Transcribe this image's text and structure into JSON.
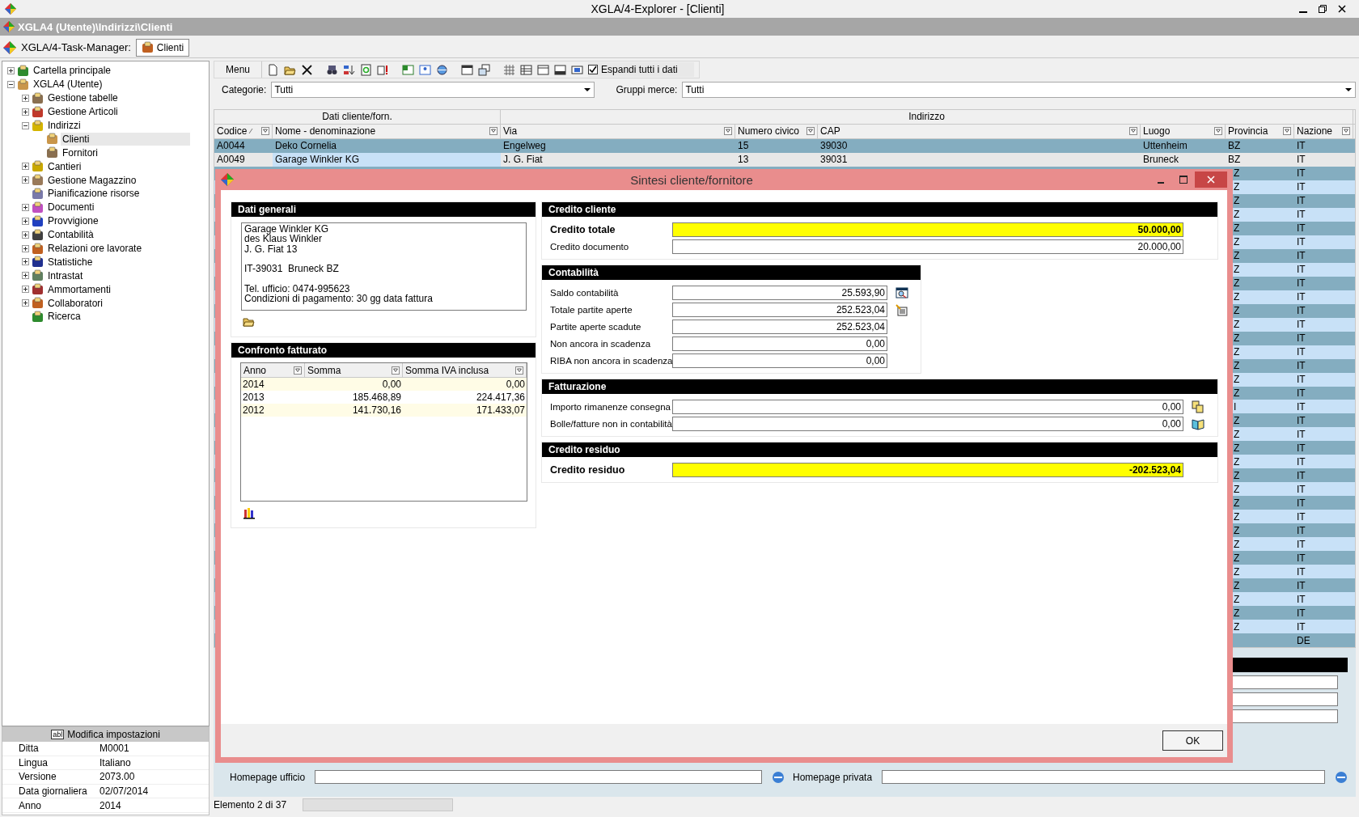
{
  "window": {
    "title": "XGLA/4-Explorer - [Clienti]"
  },
  "path_bar": {
    "text": "XGLA4 (Utente)\\Indirizzi\\Clienti"
  },
  "task_bar": {
    "label": "XGLA/4-Task-Manager:",
    "tabs": [
      {
        "label": "Clienti",
        "selected": true
      }
    ]
  },
  "tree": [
    {
      "label": "Cartella principale",
      "expanded": false,
      "selected": false
    },
    {
      "label": "XGLA4 (Utente)",
      "expanded": true,
      "selected": false,
      "children": [
        {
          "label": "Gestione tabelle",
          "expanded": false,
          "selected": false
        },
        {
          "label": "Gestione Articoli",
          "expanded": false,
          "selected": false
        },
        {
          "label": "Indirizzi",
          "expanded": true,
          "selected": false,
          "children": [
            {
              "label": "Clienti",
              "selected": true
            },
            {
              "label": "Fornitori",
              "selected": false
            }
          ]
        },
        {
          "label": "Cantieri",
          "expanded": false,
          "selected": false
        },
        {
          "label": "Gestione Magazzino",
          "expanded": false,
          "selected": false
        },
        {
          "label": "Pianificazione risorse",
          "selected": false
        },
        {
          "label": "Documenti",
          "expanded": false,
          "selected": false
        },
        {
          "label": "Provvigione",
          "expanded": false,
          "selected": false
        },
        {
          "label": "Contabilità",
          "expanded": false,
          "selected": false
        },
        {
          "label": "Relazioni ore lavorate",
          "expanded": false,
          "selected": false
        },
        {
          "label": "Statistiche",
          "expanded": false,
          "selected": false
        },
        {
          "label": "Intrastat",
          "expanded": false,
          "selected": false
        },
        {
          "label": "Ammortamenti",
          "expanded": false,
          "selected": false
        },
        {
          "label": "Collaboratori",
          "expanded": false,
          "selected": false
        },
        {
          "label": "Ricerca",
          "selected": false
        }
      ]
    }
  ],
  "settings": {
    "icon_text": "abl",
    "title": "Modifica impostazioni",
    "rows": [
      {
        "label": "Ditta",
        "value": "M0001"
      },
      {
        "label": "Lingua",
        "value": "Italiano"
      },
      {
        "label": "Versione",
        "value": "2073.00"
      },
      {
        "label": "Data giornaliera",
        "value": "02/07/2014"
      },
      {
        "label": "Anno",
        "value": "2014"
      }
    ]
  },
  "toolbar": {
    "menu": "Menu",
    "expand_all": {
      "label": "Espandi tutti i dati",
      "checked": true
    }
  },
  "filters": [
    {
      "label": "Categorie:",
      "value": "Tutti"
    },
    {
      "label": "Gruppi merce:",
      "value": "Tutti"
    }
  ],
  "table": {
    "groups": [
      {
        "label": "Dati cliente/forn."
      },
      {
        "label": "Indirizzo"
      }
    ],
    "columns": [
      {
        "label": "Codice",
        "sorted": true
      },
      {
        "label": "Nome - denominazione",
        "sorted": false
      },
      {
        "label": "Via",
        "sorted": false
      },
      {
        "label": "Numero civico",
        "sorted": false
      },
      {
        "label": "CAP",
        "sorted": false
      },
      {
        "label": "Luogo",
        "sorted": false
      },
      {
        "label": "Provincia",
        "sorted": false
      },
      {
        "label": "Nazione",
        "sorted": false
      }
    ],
    "rows": [
      {
        "kind": "full",
        "selected": false,
        "cells": [
          "A0044",
          "Deko Cornelia",
          "Engelweg",
          "15",
          "39030",
          "Uttenheim",
          "BZ",
          "IT"
        ]
      },
      {
        "kind": "full",
        "selected": true,
        "cells": [
          "A0049",
          "Garage Winkler KG",
          "J. G. Fiat",
          "13",
          "39031",
          "Bruneck",
          "BZ",
          "IT"
        ]
      },
      {
        "kind": "covered",
        "selected": false,
        "provincia": "Z",
        "nazione": "IT"
      },
      {
        "kind": "covered",
        "selected": false,
        "provincia": "Z",
        "nazione": "IT"
      },
      {
        "kind": "covered",
        "selected": false,
        "provincia": "Z",
        "nazione": "IT"
      },
      {
        "kind": "covered",
        "selected": false,
        "provincia": "Z",
        "nazione": "IT"
      },
      {
        "kind": "covered",
        "selected": false,
        "provincia": "Z",
        "nazione": "IT"
      },
      {
        "kind": "covered",
        "selected": false,
        "provincia": "Z",
        "nazione": "IT"
      },
      {
        "kind": "covered",
        "selected": false,
        "provincia": "Z",
        "nazione": "IT"
      },
      {
        "kind": "covered",
        "selected": false,
        "provincia": "Z",
        "nazione": "IT"
      },
      {
        "kind": "covered",
        "selected": false,
        "provincia": "Z",
        "nazione": "IT"
      },
      {
        "kind": "covered",
        "selected": false,
        "provincia": "Z",
        "nazione": "IT"
      },
      {
        "kind": "covered",
        "selected": false,
        "provincia": "Z",
        "nazione": "IT"
      },
      {
        "kind": "covered",
        "selected": false,
        "provincia": "Z",
        "nazione": "IT"
      },
      {
        "kind": "covered",
        "selected": false,
        "provincia": "Z",
        "nazione": "IT"
      },
      {
        "kind": "covered",
        "selected": false,
        "provincia": "Z",
        "nazione": "IT"
      },
      {
        "kind": "covered",
        "selected": false,
        "provincia": "Z",
        "nazione": "IT"
      },
      {
        "kind": "covered",
        "selected": false,
        "provincia": "Z",
        "nazione": "IT"
      },
      {
        "kind": "covered",
        "selected": false,
        "provincia": "Z",
        "nazione": "IT"
      },
      {
        "kind": "covered",
        "selected": false,
        "provincia": "I",
        "nazione": "IT"
      },
      {
        "kind": "covered",
        "selected": false,
        "provincia": "Z",
        "nazione": "IT"
      },
      {
        "kind": "covered",
        "selected": false,
        "provincia": "Z",
        "nazione": "IT"
      },
      {
        "kind": "covered",
        "selected": false,
        "provincia": "Z",
        "nazione": "IT"
      },
      {
        "kind": "covered",
        "selected": false,
        "provincia": "Z",
        "nazione": "IT"
      },
      {
        "kind": "covered",
        "selected": false,
        "provincia": "Z",
        "nazione": "IT"
      },
      {
        "kind": "covered",
        "selected": false,
        "provincia": "Z",
        "nazione": "IT"
      },
      {
        "kind": "covered",
        "selected": false,
        "provincia": "Z",
        "nazione": "IT"
      },
      {
        "kind": "covered",
        "selected": false,
        "provincia": "Z",
        "nazione": "IT"
      },
      {
        "kind": "covered",
        "selected": false,
        "provincia": "Z",
        "nazione": "IT"
      },
      {
        "kind": "covered",
        "selected": false,
        "provincia": "Z",
        "nazione": "IT"
      },
      {
        "kind": "covered",
        "selected": false,
        "provincia": "Z",
        "nazione": "IT"
      },
      {
        "kind": "covered",
        "selected": false,
        "provincia": "Z",
        "nazione": "IT"
      },
      {
        "kind": "covered",
        "selected": false,
        "provincia": "Z",
        "nazione": "IT"
      },
      {
        "kind": "covered",
        "selected": false,
        "provincia": "Z",
        "nazione": "IT"
      },
      {
        "kind": "covered",
        "selected": false,
        "provincia": "Z",
        "nazione": "IT"
      },
      {
        "kind": "covered",
        "selected": false,
        "provincia": "Z",
        "nazione": "IT"
      },
      {
        "kind": "covered",
        "selected": false,
        "nazione": "DE"
      }
    ]
  },
  "detail": {
    "homepage_left": "Homepage ufficio",
    "homepage_right": "Homepage privata"
  },
  "status_bar": {
    "text": "Elemento 2 di 37"
  },
  "dialog": {
    "title": "Sintesi cliente/fornitore",
    "general": {
      "title": "Dati generali",
      "address": [
        [
          "Garage Winkler KG",
          "des Klaus Winkler",
          "J. G. Fiat 13"
        ],
        [
          "IT-39031  Bruneck BZ"
        ],
        [
          "Tel. ufficio: 0474-995623",
          "Condizioni di pagamento: 30 gg data fattura"
        ]
      ]
    },
    "turnover": {
      "title": "Confronto fatturato",
      "columns": [
        "Anno",
        "Somma",
        "Somma IVA inclusa"
      ],
      "rows": [
        [
          "2014",
          "0,00",
          "0,00"
        ],
        [
          "2013",
          "185.468,89",
          "224.417,36"
        ],
        [
          "2012",
          "141.730,16",
          "171.433,07"
        ]
      ]
    },
    "credit": {
      "title": "Credito cliente",
      "rows": [
        {
          "label": "Credito totale",
          "value": "50.000,00",
          "highlight": true
        },
        {
          "label": "Credito documento",
          "value": "20.000,00",
          "highlight": false
        }
      ]
    },
    "accounting": {
      "title": "Contabilità",
      "rows": [
        {
          "label": "Saldo contabilità",
          "value": "25.593,90",
          "highlight": false
        },
        {
          "label": "Totale partite aperte",
          "value": "252.523,04",
          "highlight": false
        },
        {
          "label": "Partite aperte scadute",
          "value": "252.523,04",
          "highlight": false
        },
        {
          "label": "Non ancora in scadenza",
          "value": "0,00",
          "highlight": false
        },
        {
          "label": "RIBA non ancora in scadenza",
          "value": "0,00",
          "highlight": false
        }
      ]
    },
    "invoicing": {
      "title": "Fatturazione",
      "rows": [
        {
          "label": "Importo rimanenze consegna",
          "value": "0,00",
          "highlight": false
        },
        {
          "label": "Bolle/fatture non in contabilità",
          "value": "0,00",
          "highlight": false
        }
      ]
    },
    "residual": {
      "title": "Credito residuo",
      "rows": [
        {
          "label": "Credito residuo",
          "value": "-202.523,04",
          "highlight": true
        }
      ]
    },
    "buttons": [
      "OK"
    ]
  }
}
